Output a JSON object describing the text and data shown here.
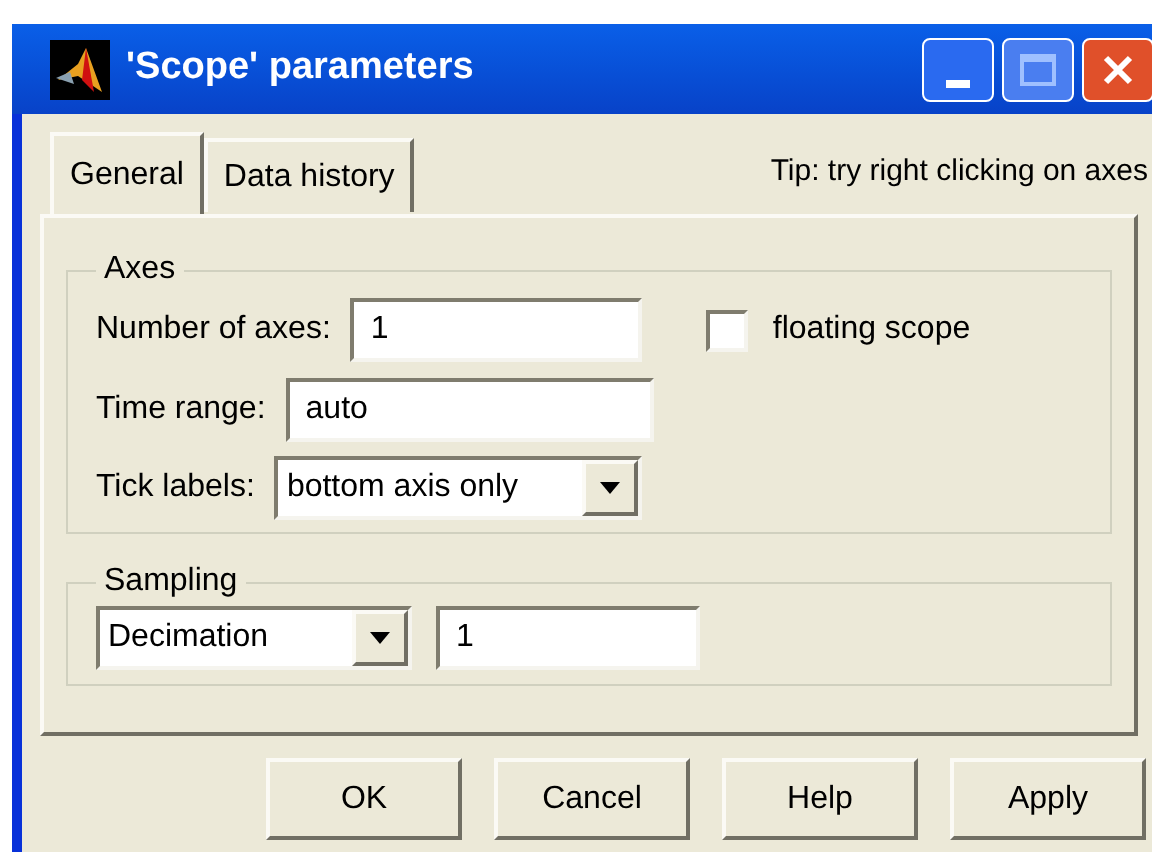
{
  "window": {
    "title": "'Scope' parameters"
  },
  "tabs": [
    {
      "label": "General",
      "selected": true
    },
    {
      "label": "Data history",
      "selected": false
    }
  ],
  "tip": "Tip:  try right clicking on axes",
  "axes": {
    "title": "Axes",
    "number_of_axes": {
      "label": "Number of axes:",
      "value": "1"
    },
    "floating_scope": {
      "label": "floating scope",
      "checked": false
    },
    "time_range": {
      "label": "Time range:",
      "value": "auto"
    },
    "tick_labels": {
      "label": "Tick labels:",
      "value": "bottom axis only"
    }
  },
  "sampling": {
    "title": "Sampling",
    "mode": "Decimation",
    "value": "1"
  },
  "buttons": [
    "OK",
    "Cancel",
    "Help",
    "Apply"
  ]
}
